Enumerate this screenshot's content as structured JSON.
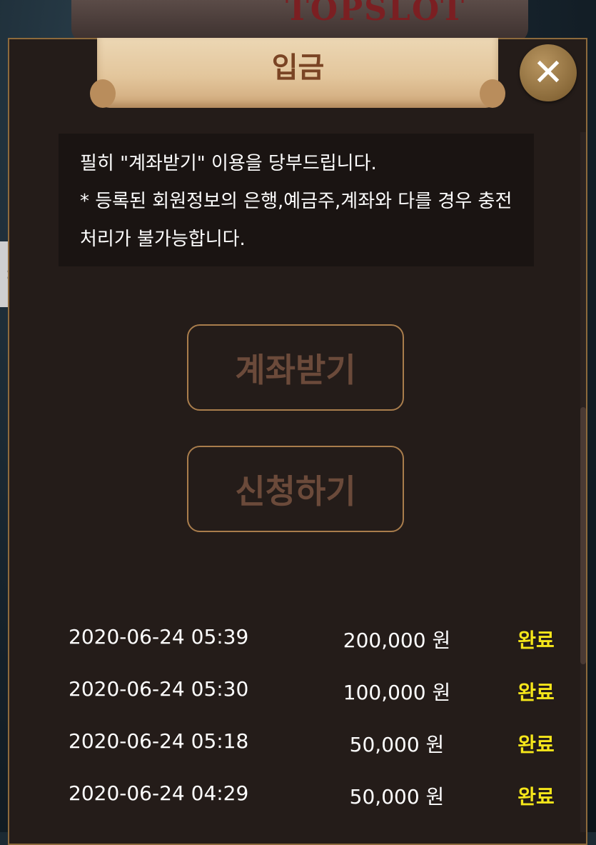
{
  "background": {
    "logo_text": "TOPSLOT"
  },
  "modal": {
    "title": "입금",
    "close_label": "✕"
  },
  "notice": {
    "line1": "필히 \"계좌받기\" 이용을 당부드립니다.",
    "line2": "* 등록된 회원정보의 은행,예금주,계좌와 다를 경우 충전처리가 불가능합니다."
  },
  "buttons": {
    "receive_account": "계좌받기",
    "apply": "신청하기"
  },
  "history": [
    {
      "datetime": "2020-06-24 05:39",
      "amount": "200,000 원",
      "status": "완료"
    },
    {
      "datetime": "2020-06-24 05:30",
      "amount": "100,000 원",
      "status": "완료"
    },
    {
      "datetime": "2020-06-24 05:18",
      "amount": "50,000 원",
      "status": "완료"
    },
    {
      "datetime": "2020-06-24 04:29",
      "amount": "50,000 원",
      "status": "완료"
    }
  ],
  "colors": {
    "modal_bg": "#241c19",
    "border": "#8d6a3c",
    "status": "#f5e61a"
  },
  "icons": {
    "close": "close-icon",
    "side_tab": "chevron-right-icon"
  }
}
